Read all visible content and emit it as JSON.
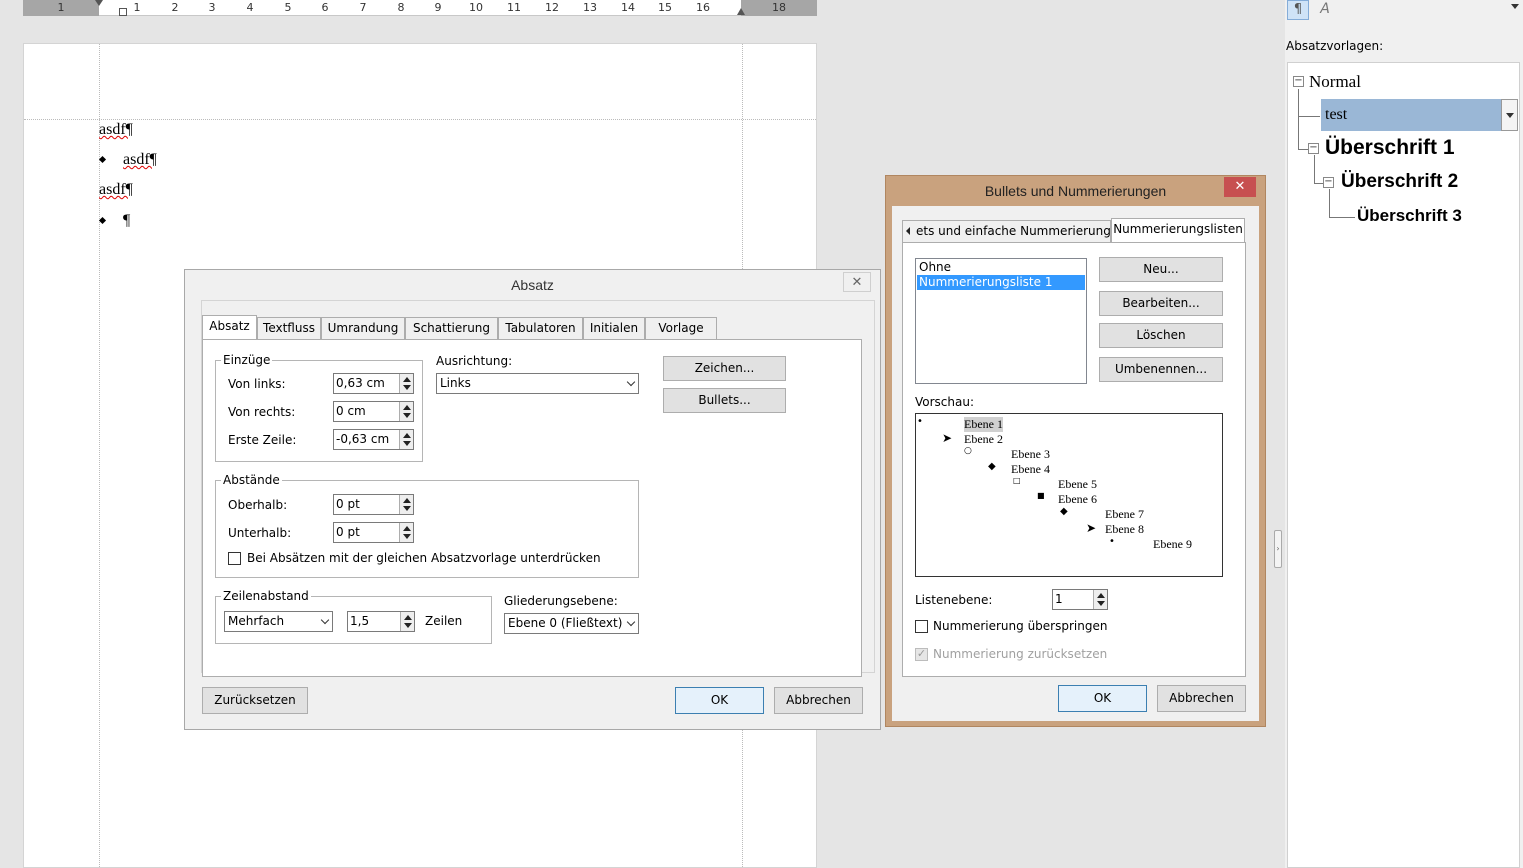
{
  "ruler": {
    "numbers": [
      "1",
      "1",
      "2",
      "3",
      "4",
      "5",
      "6",
      "7",
      "8",
      "9",
      "10",
      "11",
      "12",
      "13",
      "14",
      "15",
      "16",
      "18"
    ]
  },
  "document": {
    "lines": [
      "asdf¶",
      "asdf¶",
      "asdf¶",
      "¶"
    ]
  },
  "sidebar": {
    "label": "Absatzvorlagen:",
    "styles": [
      "Normal",
      "test",
      "Überschrift 1",
      "Überschrift 2",
      "Überschrift 3"
    ]
  },
  "absatz": {
    "title": "Absatz",
    "tabs": [
      "Absatz",
      "Textfluss",
      "Umrandung",
      "Schattierung",
      "Tabulatoren",
      "Initialen",
      "Vorlage"
    ],
    "einzuege": {
      "label": "Einzüge",
      "von_links": "Von links:",
      "von_links_val": "0,63 cm",
      "von_rechts": "Von rechts:",
      "von_rechts_val": "0 cm",
      "erste_zeile": "Erste Zeile:",
      "erste_zeile_val": "-0,63 cm"
    },
    "ausrichtung": {
      "label": "Ausrichtung:",
      "value": "Links"
    },
    "zeichen_btn": "Zeichen...",
    "bullets_btn": "Bullets...",
    "abstaende": {
      "label": "Abstände",
      "oberhalb": "Oberhalb:",
      "oberhalb_val": "0 pt",
      "unterhalb": "Unterhalb:",
      "unterhalb_val": "0 pt",
      "checkbox": "Bei Absätzen mit der gleichen Absatzvorlage unterdrücken"
    },
    "zeilenabstand": {
      "label": "Zeilenabstand",
      "mode": "Mehrfach",
      "value": "1,5",
      "unit": "Zeilen"
    },
    "gliederung": {
      "label": "Gliederungsebene:",
      "value": "Ebene 0 (Fließtext)"
    },
    "reset_btn": "Zurücksetzen",
    "ok_btn": "OK",
    "cancel_btn": "Abbrechen"
  },
  "bullets": {
    "title": "Bullets und Nummerierungen",
    "tab1": "ets und einfache Nummerierungen",
    "tab2": "Nummerierungslisten",
    "list": [
      "Ohne",
      "Nummerierungsliste 1"
    ],
    "neu_btn": "Neu...",
    "bearbeiten_btn": "Bearbeiten...",
    "loeschen_btn": "Löschen",
    "umbenennen_btn": "Umbenennen...",
    "vorschau_label": "Vorschau:",
    "levels": [
      "Ebene 1",
      "Ebene 2",
      "Ebene 3",
      "Ebene 4",
      "Ebene 5",
      "Ebene 6",
      "Ebene 7",
      "Ebene 8",
      "Ebene 9"
    ],
    "listenebene_label": "Listenebene:",
    "listenebene_val": "1",
    "skip_label": "Nummerierung überspringen",
    "reset_label": "Nummerierung zurücksetzen",
    "ok_btn": "OK",
    "cancel_btn": "Abbrechen"
  },
  "colors": {
    "bullets_frame": "#c9a27e",
    "close_red": "#c75050",
    "selection_blue": "#9ab7d6"
  }
}
